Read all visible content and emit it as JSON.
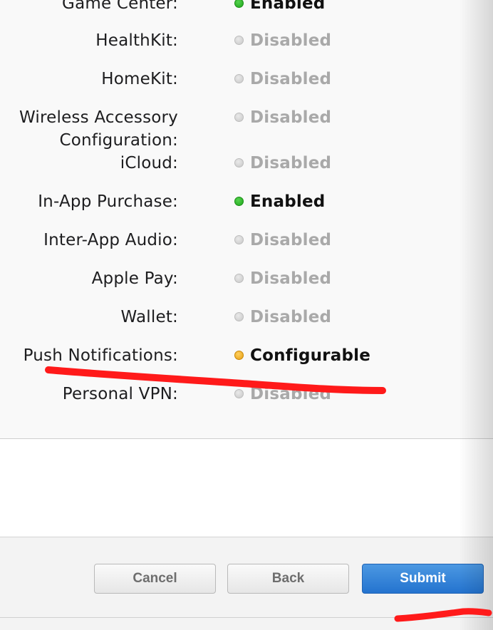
{
  "services": [
    {
      "label": "Game Center:",
      "status": "Enabled",
      "state": "enabled"
    },
    {
      "label": "HealthKit:",
      "status": "Disabled",
      "state": "disabled"
    },
    {
      "label": "HomeKit:",
      "status": "Disabled",
      "state": "disabled"
    },
    {
      "label": "Wireless Accessory Configuration:",
      "status": "Disabled",
      "state": "disabled"
    },
    {
      "label": "iCloud:",
      "status": "Disabled",
      "state": "disabled"
    },
    {
      "label": "In-App Purchase:",
      "status": "Enabled",
      "state": "enabled"
    },
    {
      "label": "Inter-App Audio:",
      "status": "Disabled",
      "state": "disabled"
    },
    {
      "label": "Apple Pay:",
      "status": "Disabled",
      "state": "disabled"
    },
    {
      "label": "Wallet:",
      "status": "Disabled",
      "state": "disabled"
    },
    {
      "label": "Push Notifications:",
      "status": "Configurable",
      "state": "configurable"
    },
    {
      "label": "Personal VPN:",
      "status": "Disabled",
      "state": "disabled"
    }
  ],
  "footer": {
    "cancel_label": "Cancel",
    "back_label": "Back",
    "submit_label": "Submit"
  },
  "colors": {
    "enabled_dot": "#2fb52a",
    "disabled_dot": "#cccccc",
    "configurable_dot": "#f0ad1c",
    "primary_button": "#2f7fd6",
    "annotation_red": "#ff1a1a"
  }
}
